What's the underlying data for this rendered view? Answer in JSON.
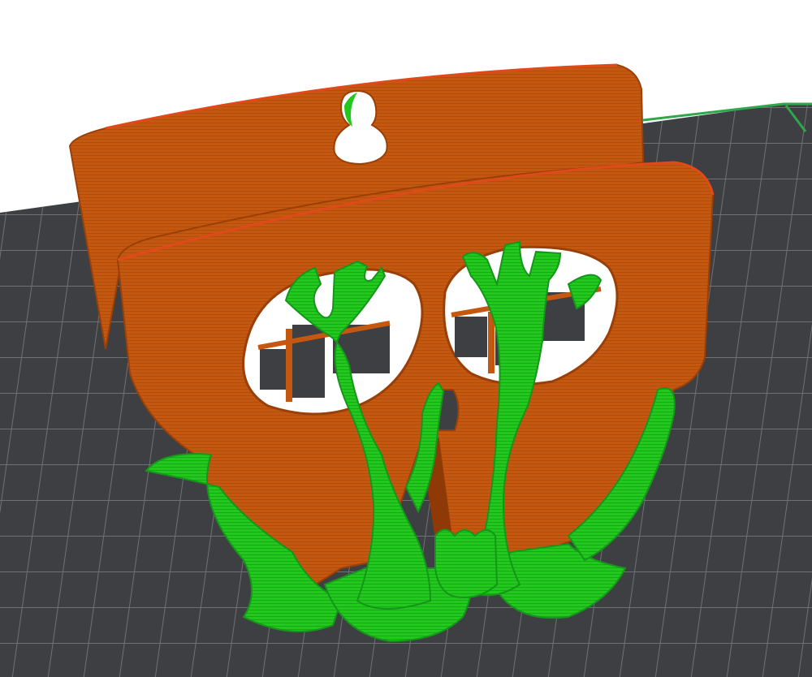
{
  "viewport": {
    "background_color": "#ffffff",
    "colors": {
      "bed": "#3d3f42",
      "bed_grid": "#6f7174",
      "bed_edge": "#2ea84a",
      "model": "#c45810",
      "model_edge": "#9a3f08",
      "model_top_edge": "#e04a1a",
      "support": "#22c81e",
      "support_shade": "#15961a"
    },
    "icons": {
      "model": "skull-wall-hook-icon",
      "supports": "tree-support-icon",
      "bed": "build-plate-icon"
    }
  }
}
